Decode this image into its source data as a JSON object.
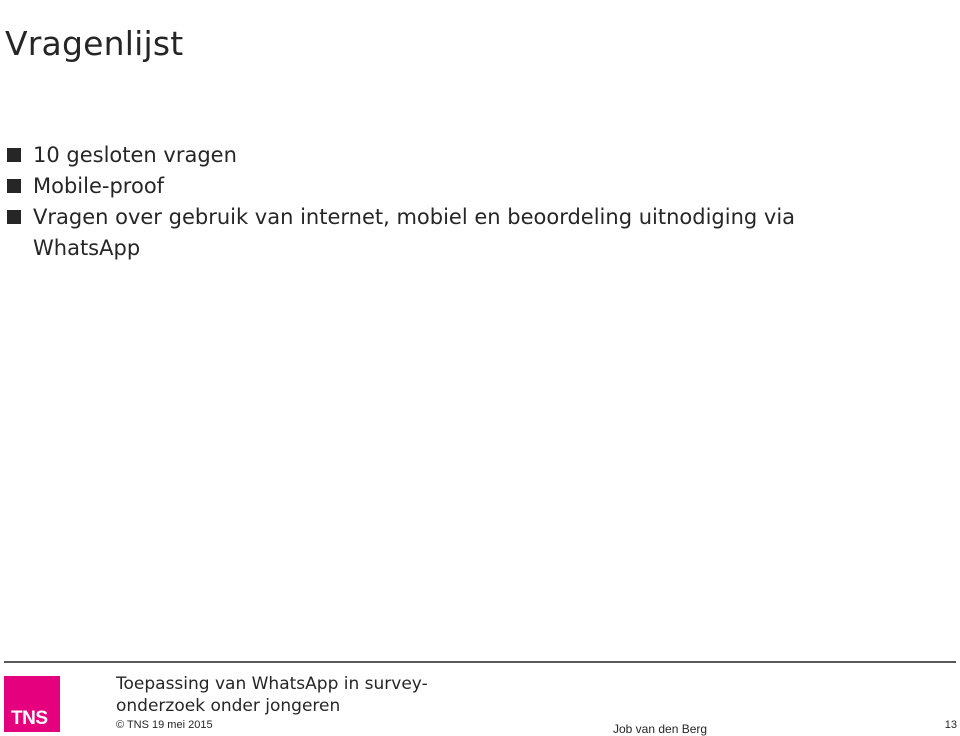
{
  "slide": {
    "title": "Vragenlijst",
    "bullets": [
      {
        "text": "10 gesloten vragen"
      },
      {
        "text": "Mobile-proof"
      },
      {
        "text": "Vragen over gebruik van internet, mobiel en beoordeling uitnodiging via WhatsApp"
      }
    ]
  },
  "footer": {
    "logo_text": "TNS",
    "logo_color": "#e5007e",
    "title": "Toepassing van WhatsApp in survey-onderzoek onder jongeren",
    "copyright": "© TNS 19 mei 2015",
    "author": "Job van den Berg",
    "page_number": "13"
  }
}
